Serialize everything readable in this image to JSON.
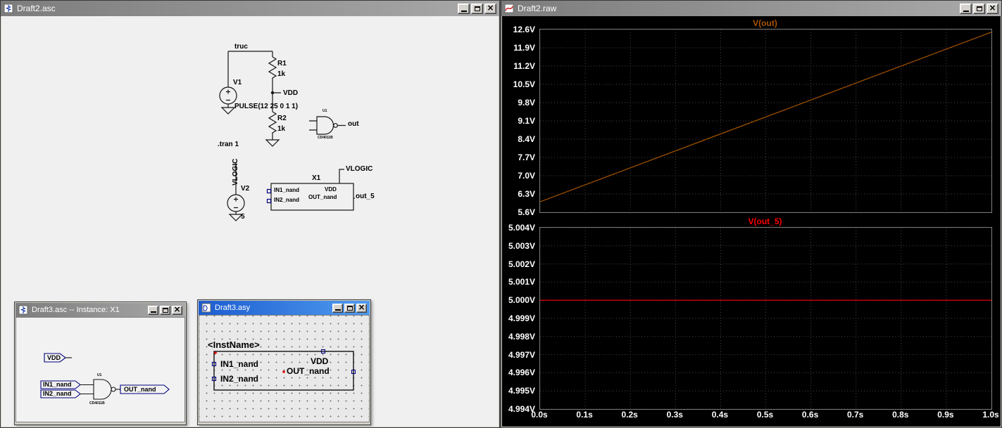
{
  "windows": {
    "schematic": {
      "title": "Draft2.asc"
    },
    "waveform": {
      "title": "Draft2.raw"
    },
    "instance": {
      "title": "Draft3.asc -- Instance: X1"
    },
    "symbol": {
      "title": "Draft3.asy"
    }
  },
  "schematic": {
    "net_truc": "truc",
    "v1_name": "V1",
    "v1_value": "PULSE(12 25 0 1 1)",
    "r1_name": "R1",
    "r1_value": "1k",
    "net_vdd": "VDD",
    "r2_name": "R2",
    "r2_value": "1k",
    "directive_tran": ".tran 1",
    "gate_ref": "U1",
    "gate_type": "CD4011B",
    "net_out": "out",
    "net_vlogic_vertical": "VLOGIC",
    "v2_name": "V2",
    "v2_value": "5",
    "x1_ref": "X1",
    "x1_pin_in1": "IN1_nand",
    "x1_pin_in2": "IN2_nand",
    "x1_pin_vdd": "VDD",
    "x1_pin_out": "OUT_nand",
    "net_vlogic": "VLOGIC",
    "net_out5": "out_5"
  },
  "instance_win": {
    "port_vdd": "VDD",
    "port_in1": "IN1_nand",
    "port_in2": "IN2_nand",
    "port_out": "OUT_nand",
    "gate_ref": "U1",
    "gate_type": "CD4011B"
  },
  "symbol_win": {
    "inst_name": "<InstName>",
    "pin_in1": "IN1_nand",
    "pin_in2": "IN2_nand",
    "pin_vdd": "VDD",
    "pin_out": "OUT_nand"
  },
  "chart_data": [
    {
      "type": "line",
      "title": "V(out)",
      "color": "#a85400",
      "bg": "#000000",
      "grid": true,
      "ylim": [
        5.6,
        12.6
      ],
      "yticks": [
        "12.6V",
        "11.9V",
        "11.2V",
        "10.5V",
        "9.8V",
        "9.1V",
        "8.4V",
        "7.7V",
        "7.0V",
        "6.3V",
        "5.6V"
      ],
      "xlim": [
        0,
        1
      ],
      "xticks": [
        "0.0s",
        "0.1s",
        "0.2s",
        "0.3s",
        "0.4s",
        "0.5s",
        "0.6s",
        "0.7s",
        "0.8s",
        "0.9s",
        "1.0s"
      ],
      "series": [
        {
          "name": "V(out)",
          "x": [
            0,
            1
          ],
          "y": [
            6.0,
            12.5
          ]
        }
      ]
    },
    {
      "type": "line",
      "title": "V(out_5)",
      "color": "#ff0000",
      "bg": "#000000",
      "grid": true,
      "ylim": [
        4.994,
        5.004
      ],
      "yticks": [
        "5.004V",
        "5.003V",
        "5.002V",
        "5.001V",
        "5.000V",
        "4.999V",
        "4.998V",
        "4.997V",
        "4.996V",
        "4.995V",
        "4.994V"
      ],
      "xlim": [
        0,
        1
      ],
      "xticks": [
        "0.0s",
        "0.1s",
        "0.2s",
        "0.3s",
        "0.4s",
        "0.5s",
        "0.6s",
        "0.7s",
        "0.8s",
        "0.9s",
        "1.0s"
      ],
      "series": [
        {
          "name": "V(out_5)",
          "x": [
            0,
            1
          ],
          "y": [
            5.0,
            5.0
          ]
        }
      ]
    }
  ]
}
